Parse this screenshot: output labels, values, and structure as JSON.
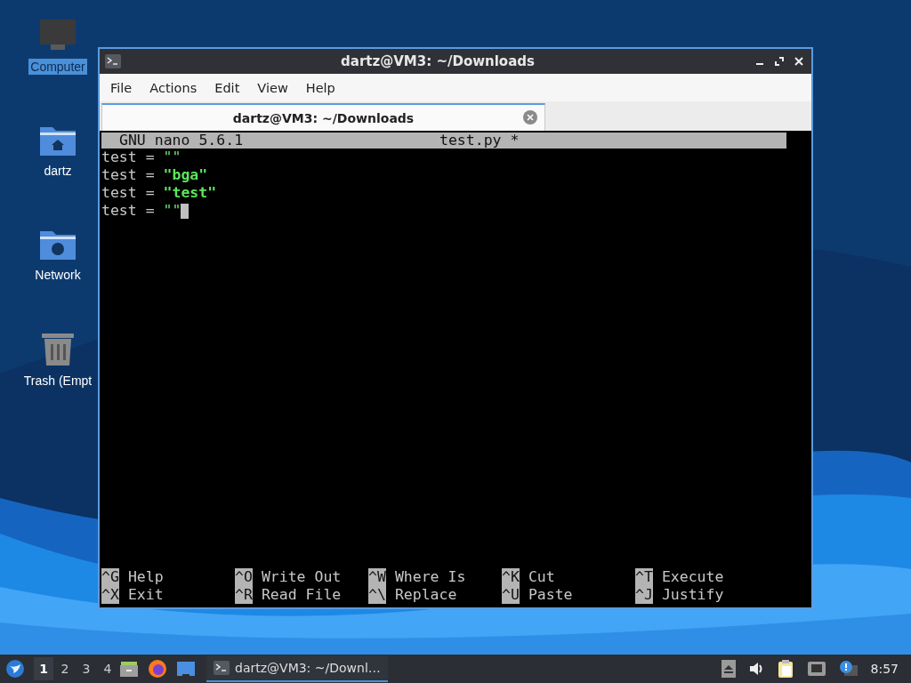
{
  "desktop": {
    "icons": [
      {
        "label": "Computer",
        "kind": "computer",
        "selected": true
      },
      {
        "label": "dartz",
        "kind": "home",
        "selected": false
      },
      {
        "label": "Network",
        "kind": "network",
        "selected": false
      },
      {
        "label": "Trash (Empt",
        "kind": "trash",
        "selected": false
      }
    ]
  },
  "window": {
    "title": "dartz@VM3: ~/Downloads",
    "menu": [
      "File",
      "Actions",
      "Edit",
      "View",
      "Help"
    ],
    "tabs": [
      {
        "label": "dartz@VM3: ~/Downloads",
        "selected": true
      }
    ],
    "nano": {
      "version": "GNU nano 5.6.1",
      "filename": "test.py *",
      "lines": [
        {
          "code": "test = ",
          "string": "\"\"",
          "bold": false,
          "cursor": false
        },
        {
          "code": "test = ",
          "string": "\"bga\"",
          "bold": true,
          "cursor": false
        },
        {
          "code": "test = ",
          "string": "\"test\"",
          "bold": true,
          "cursor": false
        },
        {
          "code": "test = ",
          "string": "\"\"",
          "bold": false,
          "cursor": true
        }
      ],
      "shortcuts": [
        [
          {
            "key": "^G",
            "label": "Help"
          },
          {
            "key": "^O",
            "label": "Write Out"
          },
          {
            "key": "^W",
            "label": "Where Is"
          },
          {
            "key": "^K",
            "label": "Cut"
          },
          {
            "key": "^T",
            "label": "Execute"
          }
        ],
        [
          {
            "key": "^X",
            "label": "Exit"
          },
          {
            "key": "^R",
            "label": "Read File"
          },
          {
            "key": "^\\",
            "label": "Replace"
          },
          {
            "key": "^U",
            "label": "Paste"
          },
          {
            "key": "^J",
            "label": "Justify"
          }
        ]
      ]
    }
  },
  "taskbar": {
    "workspaces": [
      {
        "label": "1",
        "selected": true
      },
      {
        "label": "2",
        "selected": false
      },
      {
        "label": "3",
        "selected": false
      },
      {
        "label": "4",
        "selected": false
      }
    ],
    "tasks": [
      {
        "label": "dartz@VM3: ~/Downl…",
        "selected": true
      }
    ],
    "clock": "8:57"
  }
}
